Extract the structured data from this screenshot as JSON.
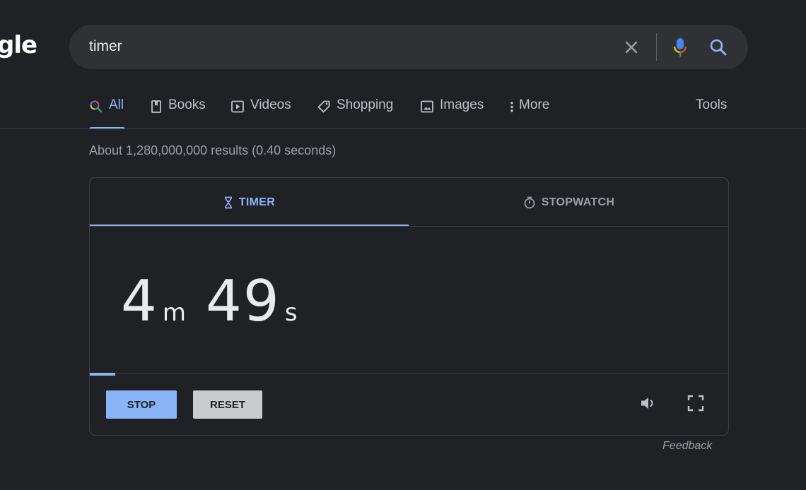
{
  "logo": {
    "text": "gle"
  },
  "search": {
    "value": "timer",
    "icons": [
      "close-icon",
      "mic-icon",
      "search-icon"
    ]
  },
  "nav": {
    "tabs": [
      {
        "label": "All",
        "icon": "search-icon",
        "active": true
      },
      {
        "label": "Books",
        "icon": "book-icon"
      },
      {
        "label": "Videos",
        "icon": "video-icon"
      },
      {
        "label": "Shopping",
        "icon": "tag-icon"
      },
      {
        "label": "Images",
        "icon": "image-icon"
      },
      {
        "label": "More",
        "icon": "more-vert-icon"
      }
    ],
    "tools": "Tools"
  },
  "results_count": "About 1,280,000,000 results (0.40 seconds)",
  "timer_card": {
    "tabs": {
      "timer": {
        "label": "TIMER",
        "icon": "hourglass-icon",
        "active": true
      },
      "stopwatch": {
        "label": "STOPWATCH",
        "icon": "stopwatch-icon"
      }
    },
    "time": {
      "minutes": "4",
      "minutes_unit": "m",
      "seconds": "49",
      "seconds_unit": "s"
    },
    "progress": 0.04,
    "buttons": {
      "stop": "STOP",
      "reset": "RESET"
    },
    "icons": [
      "sound-icon",
      "fullscreen-icon"
    ]
  },
  "feedback": "Feedback",
  "colors": {
    "background": "#202124",
    "accent": "#8ab4f8",
    "searchbar": "#303134",
    "text": "#bdc1c6"
  }
}
